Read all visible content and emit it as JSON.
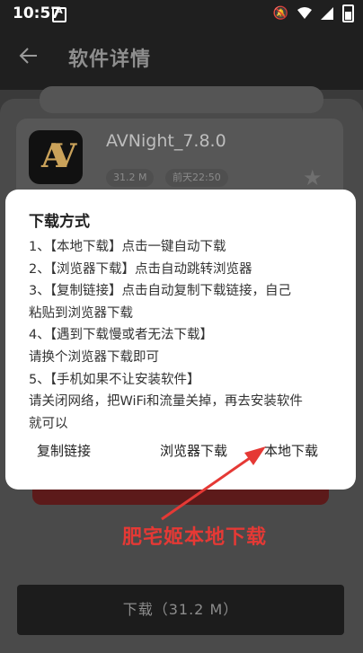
{
  "status_bar": {
    "time": "10:57",
    "icons": [
      "notification-icon",
      "mute-icon",
      "wifi-icon",
      "signal-icon",
      "battery-icon"
    ]
  },
  "app_bar": {
    "back_icon": "back-arrow-icon",
    "title": "软件详情"
  },
  "app_info": {
    "name": "AVNight_7.8.0",
    "size": "31.2 M",
    "updated": "前天22:50",
    "logo_text": "AV",
    "favorite_icon": "star-icon"
  },
  "dialog": {
    "title": "下载方式",
    "lines": [
      "1、【本地下载】点击一键自动下载",
      "2、【浏览器下载】点击自动跳转浏览器",
      "3、【复制链接】点击自动复制下载链接，自己",
      "粘贴到浏览器下载",
      "4、【遇到下载慢或者无法下载】",
      "请换个浏览器下载即可",
      "5、【手机如果不让安装软件】",
      "请关闭网络，把WiFi和流量关掉，再去安装软件",
      "就可以"
    ],
    "actions": {
      "copy": "复制链接",
      "browser": "浏览器下载",
      "local": "本地下载"
    }
  },
  "download_button": "下载（31.2 M）",
  "annotation": {
    "text": "肥宅姬本地下载",
    "color": "#e53935"
  }
}
